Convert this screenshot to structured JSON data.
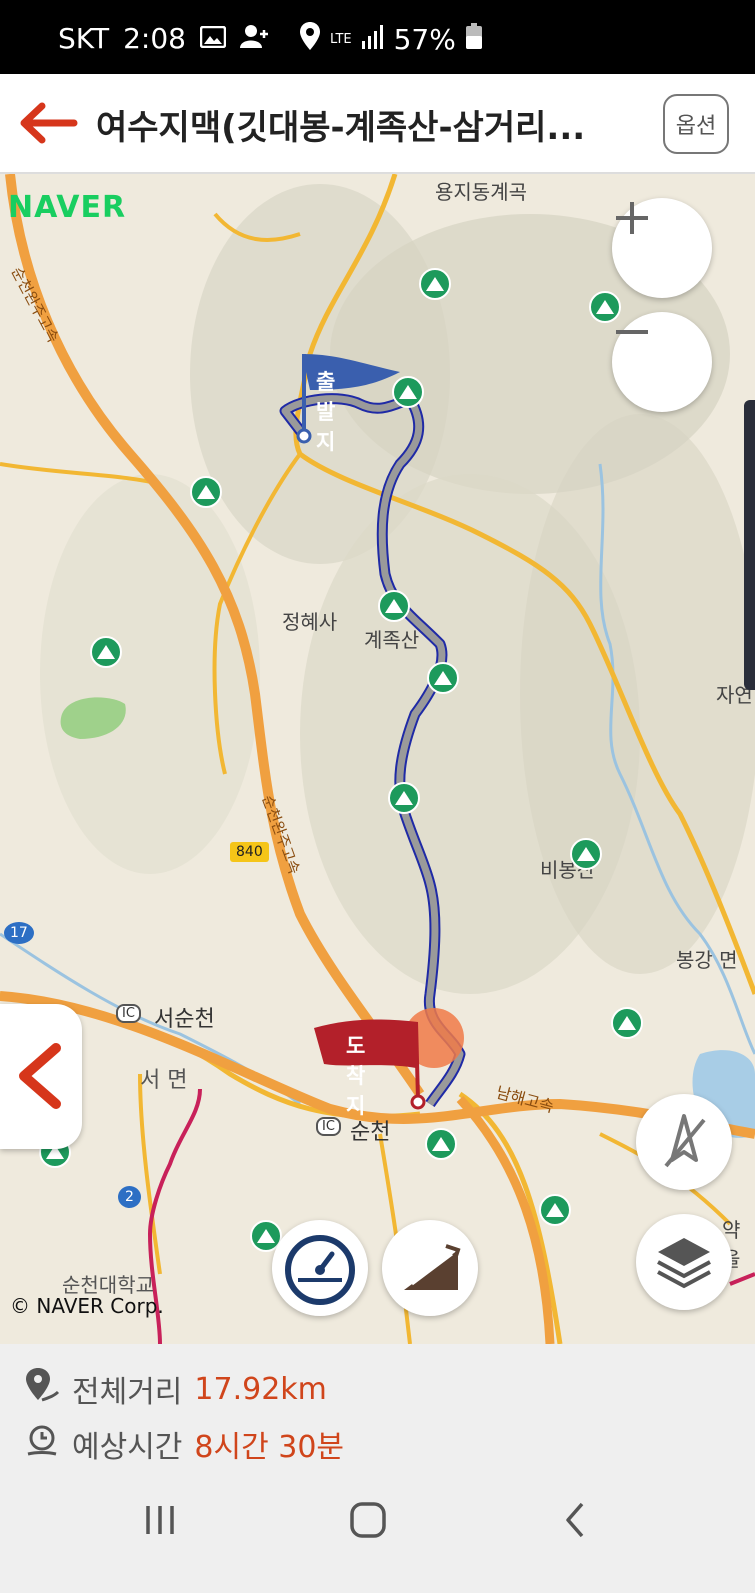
{
  "status_bar": {
    "carrier": "SKT",
    "time": "2:08",
    "network": "LTE",
    "battery": "57%"
  },
  "header": {
    "title": "여수지맥(깃대봉-계족산-삼거리...",
    "option_label": "옵션"
  },
  "map": {
    "provider_logo": "NAVER",
    "copyright": "© NAVER Corp.",
    "start_flag": "출발지",
    "end_flag": "도착지",
    "places": {
      "yongji": "용지동계곡",
      "jeonghyesa": "정혜사",
      "gyejoksan": "계족산",
      "bibongsan": "비봉산",
      "bonggang": "봉강 면",
      "seosuncheon": "서순천",
      "seomyeon": "서 면",
      "suncheon": "순천",
      "expressway1": "순천완주고속",
      "expressway2": "순천완주고속",
      "namhae": "남해고속",
      "university": "순천대학교",
      "edge_right": "자연",
      "edge_right2": "약을"
    },
    "road_shields": {
      "r840": "840",
      "r17": "17",
      "r2": "2"
    },
    "ic_label": "IC"
  },
  "summary": {
    "distance_label": "전체거리",
    "distance_value": "17.92km",
    "time_label": "예상시간",
    "time_value": "8시간 30분"
  },
  "colors": {
    "accent": "#d0451b",
    "route": "#1f2aa6",
    "peak_green": "#1d9a5c",
    "start_flag": "#3a5fae",
    "end_flag": "#b3202a"
  }
}
